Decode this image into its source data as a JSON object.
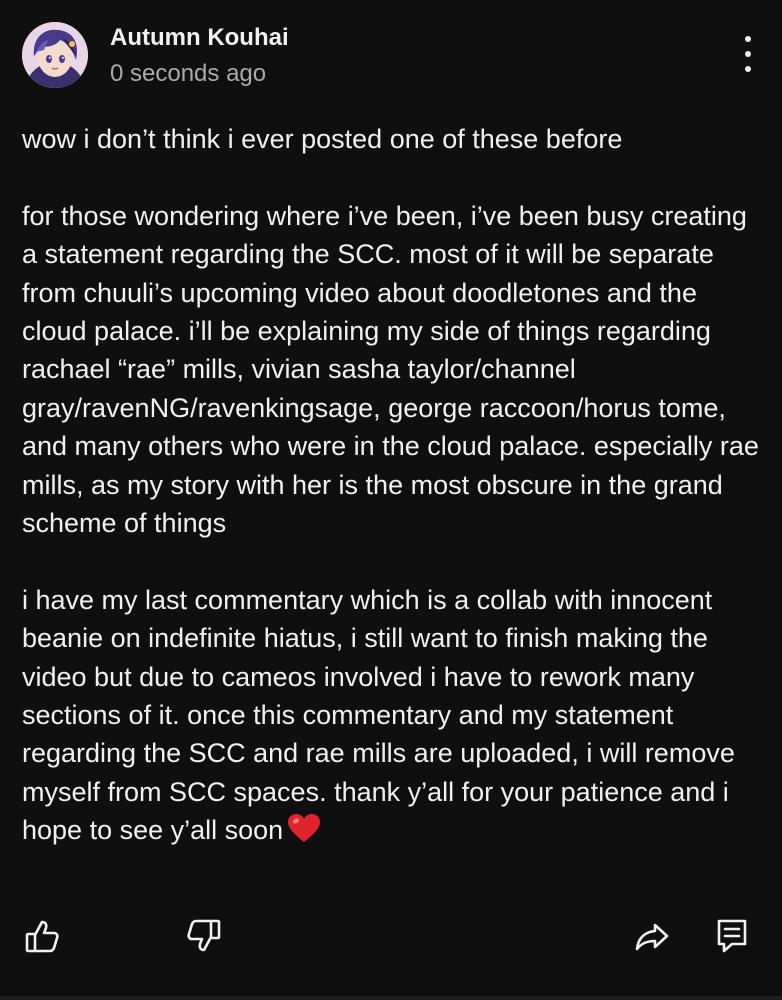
{
  "comment": {
    "author": "Autumn Kouhai",
    "timestamp": "0 seconds ago",
    "paragraphs": [
      "wow i don’t think i ever posted one of these before",
      "for those wondering where i’ve been, i’ve been busy creating a statement regarding the SCC. most of it will be separate from chuuli’s upcoming video about doodletones and the cloud palace. i’ll be explaining my side of things regarding rachael “rae” mills, vivian sasha taylor/channel gray/ravenNG/ravenkingsage, george raccoon/horus tome, and many others who were in the cloud palace. especially rae mills, as my story with her is the most obscure in the grand scheme of things",
      "i have my last commentary which is a collab with innocent beanie on indefinite hiatus, i still want to finish making the video but due to cameos involved i have to rework many sections of it. once this commentary and my statement regarding the SCC and rae mills are uploaded, i will remove myself from SCC spaces. thank y’all for your patience and i hope to see y’all soon"
    ],
    "trailing_emoji": "heart-emoji"
  },
  "actions": {
    "like_icon": "thumbs-up-icon",
    "dislike_icon": "thumbs-down-icon",
    "share_icon": "share-icon",
    "reply_icon": "reply-icon"
  },
  "menu_icon": "more-vert-icon",
  "colors": {
    "background": "#0f0f0f",
    "text": "#f1f1f1",
    "secondary_text": "#aaaaaa",
    "heart": "#e0242e"
  }
}
